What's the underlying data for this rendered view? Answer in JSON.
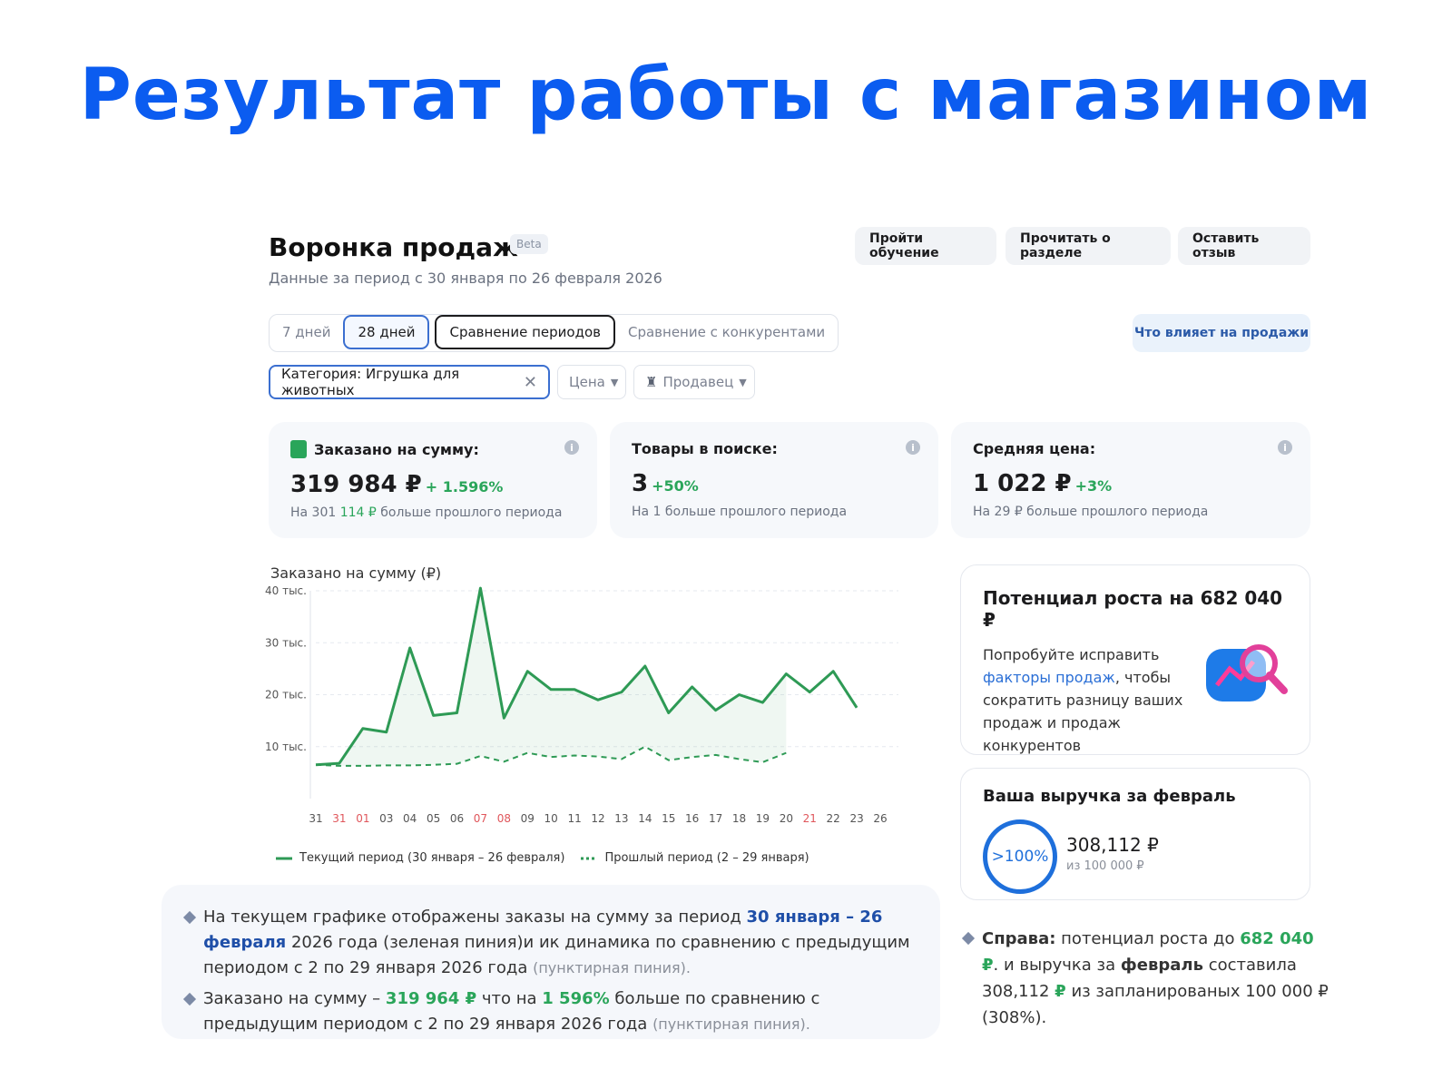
{
  "slide_title": "Результат работы с магазином",
  "header": {
    "title": "Воронка продаж",
    "badge": "Beta",
    "subtitle": "Данные за период с 30 января по 26 февраля 2026",
    "buttons": [
      "Пройти обучение",
      "Прочитать о разделе",
      "Оставить отзыв"
    ]
  },
  "period_tabs": [
    "7 дней",
    "28 дней",
    "Сравнение периодов",
    "Сравнение с конкурентами"
  ],
  "influence_button": "Что влияет на продажи",
  "filters": {
    "category": "Категория: Игрушка для животных",
    "price": "Цена",
    "seller": "Продавец"
  },
  "cards": [
    {
      "title": "Заказано на сумму:",
      "value": "319 984 ₽",
      "delta": "+ 1.596%",
      "note_prefix": "На 301",
      "note_green": "114 ₽",
      "note_suffix": "больше прошлого периода"
    },
    {
      "title": "Товары в поиске:",
      "value": "3",
      "delta": "+50%",
      "note": "На 1 больше прошлого периода"
    },
    {
      "title": "Средняя цена:",
      "value": "1 022 ₽",
      "delta": "+3%",
      "note": "На 29 ₽ больше прошлого периода"
    }
  ],
  "chart_data": {
    "type": "line",
    "title": "Заказано на сумму (₽)",
    "categories": [
      "31",
      "31",
      "01",
      "03",
      "04",
      "05",
      "06",
      "07",
      "08",
      "09",
      "10",
      "11",
      "12",
      "13",
      "14",
      "15",
      "16",
      "17",
      "18",
      "19",
      "20",
      "21",
      "22",
      "23",
      "26"
    ],
    "weekend_indices": [
      1,
      2,
      7,
      8,
      21
    ],
    "y_ticks": [
      {
        "value": 10000,
        "label": "10 тыс."
      },
      {
        "value": 20000,
        "label": "20 тыс."
      },
      {
        "value": 30000,
        "label": "30 тыс."
      },
      {
        "value": 40000,
        "label": "40 тыс."
      }
    ],
    "ylim": [
      0,
      40000
    ],
    "series": [
      {
        "name": "Текущий период (30 января – 26 февраля)",
        "style": "solid",
        "color": "#2e9a55",
        "values": [
          6500,
          6800,
          13500,
          12800,
          29000,
          16000,
          16500,
          40500,
          15500,
          24500,
          21000,
          21000,
          19000,
          20500,
          25500,
          16500,
          21500,
          17000,
          20000,
          18500,
          24000,
          20500,
          24500,
          17500
        ]
      },
      {
        "name": "Прошлый период (2 – 29 января)",
        "style": "dashed",
        "color": "#2e9a55",
        "values": [
          6500,
          6300,
          6300,
          6400,
          6400,
          6500,
          6700,
          8200,
          7100,
          8800,
          8000,
          8300,
          8100,
          7600,
          10000,
          7400,
          8000,
          8400,
          7600,
          7000,
          8800
        ]
      }
    ]
  },
  "potential": {
    "title": "Потенциал роста на 682 040 ₽",
    "text_before": "Попробуйте исправить",
    "link": "факторы продаж",
    "text_after": ", чтобы сократить разницу ваших продаж и продаж конкурентов"
  },
  "revenue": {
    "title": "Ваша выручка за февраль",
    "percent": ">100%",
    "amount": "308,112 ₽",
    "target": "из 100 000 ₽"
  },
  "notes": {
    "b1_a": "На текущем графике отображены заказы на сумму за период",
    "b1_b": "30 января – 26 февраля",
    "b1_c": "2026 года (зеленая пиния)и ик динамика по сравнению с предыдущим периодом с 2 по 29 января 2026 года",
    "b1_d": "(пунктирная пиния).",
    "b2_a": "Заказано на сумму –",
    "b2_b": "319 964 ₽",
    "b2_c": "что на",
    "b2_d": "1 596%",
    "b2_e": "больше по сравнению с предыдущим периодом с 2 по 29 января 2026 года",
    "b2_f": "(пунктирная пиния)."
  },
  "right_note": {
    "label": "Справа:",
    "t1": "потенциал роста до",
    "v1": "682 040 ₽",
    "t2": ". и выручка за",
    "t3": "февраль",
    "t4": "составила 308,112",
    "v2": "₽",
    "t5": "из запланированых 100 000 ₽ (308%)."
  },
  "colors": {
    "accent": "#0b5cf0",
    "green": "#2aa55a",
    "blue_dark": "#1f4fa8"
  }
}
